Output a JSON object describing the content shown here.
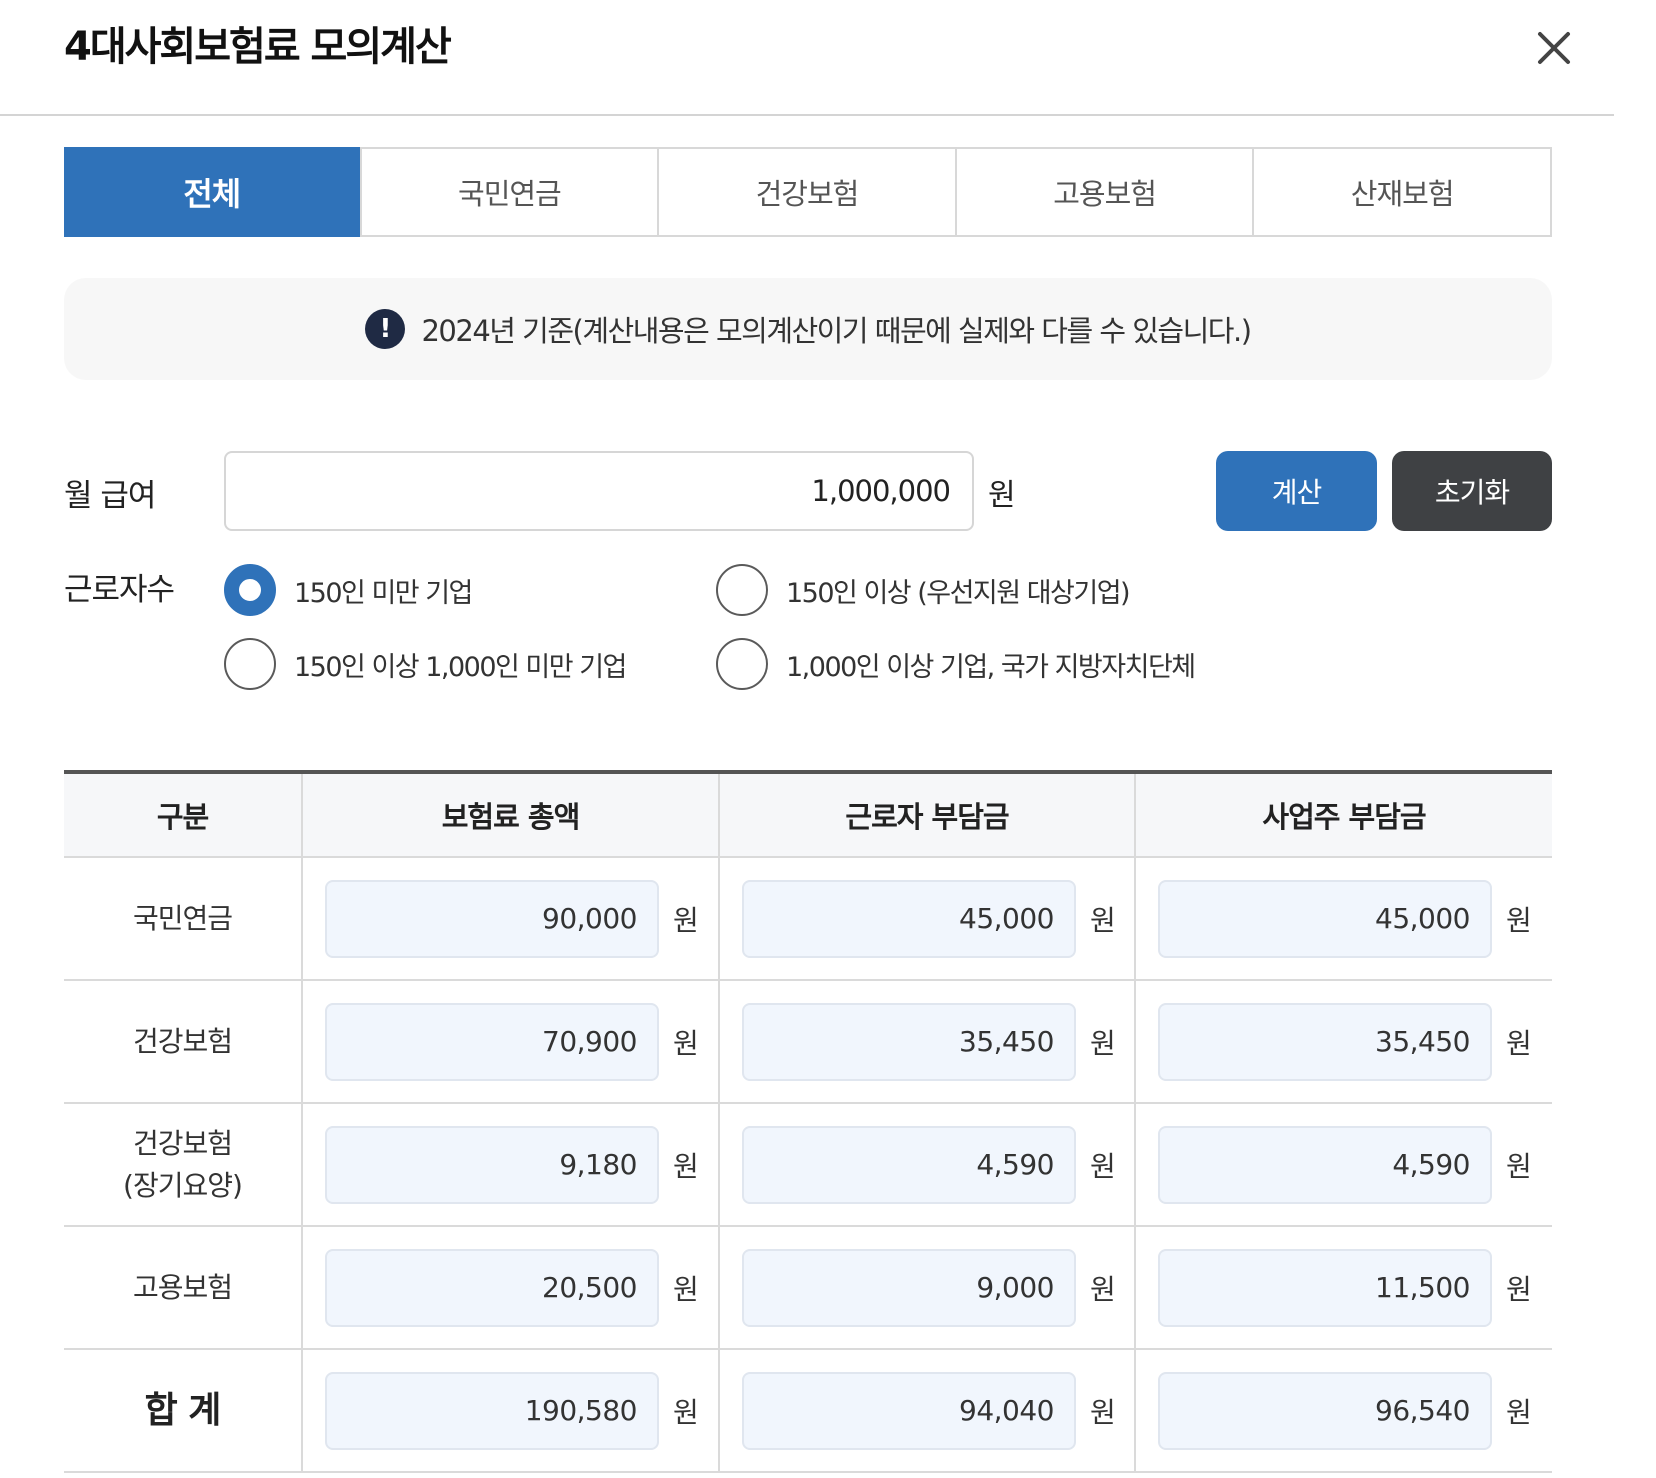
{
  "modal": {
    "title": "4대사회보험료 모의계산"
  },
  "tabs": [
    {
      "label": "전체",
      "active": true
    },
    {
      "label": "국민연금",
      "active": false
    },
    {
      "label": "건강보험",
      "active": false
    },
    {
      "label": "고용보험",
      "active": false
    },
    {
      "label": "산재보험",
      "active": false
    }
  ],
  "notice": {
    "icon": "exclamation-icon",
    "icon_glyph": "!",
    "text": "2024년 기준(계산내용은 모의계산이기 때문에 실제와 다를 수 있습니다.)"
  },
  "salary": {
    "label": "월 급여",
    "value": "1,000,000",
    "unit": "원"
  },
  "buttons": {
    "calculate": "계산",
    "reset": "초기화"
  },
  "workers": {
    "label": "근로자수",
    "options": [
      {
        "label": "150인 미만 기업",
        "checked": true
      },
      {
        "label": "150인 이상 (우선지원 대상기업)",
        "checked": false
      },
      {
        "label": "150인 이상 1,000인 미만 기업",
        "checked": false
      },
      {
        "label": "1,000인 이상 기업, 국가 지방자치단체",
        "checked": false
      }
    ]
  },
  "table": {
    "headers": [
      "구분",
      "보험료 총액",
      "근로자 부담금",
      "사업주 부담금"
    ],
    "unit": "원",
    "rows": [
      {
        "category": "국민연금",
        "category_line2": "",
        "total": "90,000",
        "employee": "45,000",
        "employer": "45,000"
      },
      {
        "category": "건강보험",
        "category_line2": "",
        "total": "70,900",
        "employee": "35,450",
        "employer": "35,450"
      },
      {
        "category": "건강보험",
        "category_line2": "(장기요양)",
        "total": "9,180",
        "employee": "4,590",
        "employer": "4,590"
      },
      {
        "category": "고용보험",
        "category_line2": "",
        "total": "20,500",
        "employee": "9,000",
        "employer": "11,500"
      },
      {
        "category": "합 계",
        "category_line2": "",
        "total": "190,580",
        "employee": "94,040",
        "employer": "96,540"
      }
    ]
  },
  "colors": {
    "primary": "#2f72b9",
    "reset_button": "#3f4144",
    "notice_icon": "#1f2a44",
    "amount_box_bg": "#f1f6fd"
  }
}
